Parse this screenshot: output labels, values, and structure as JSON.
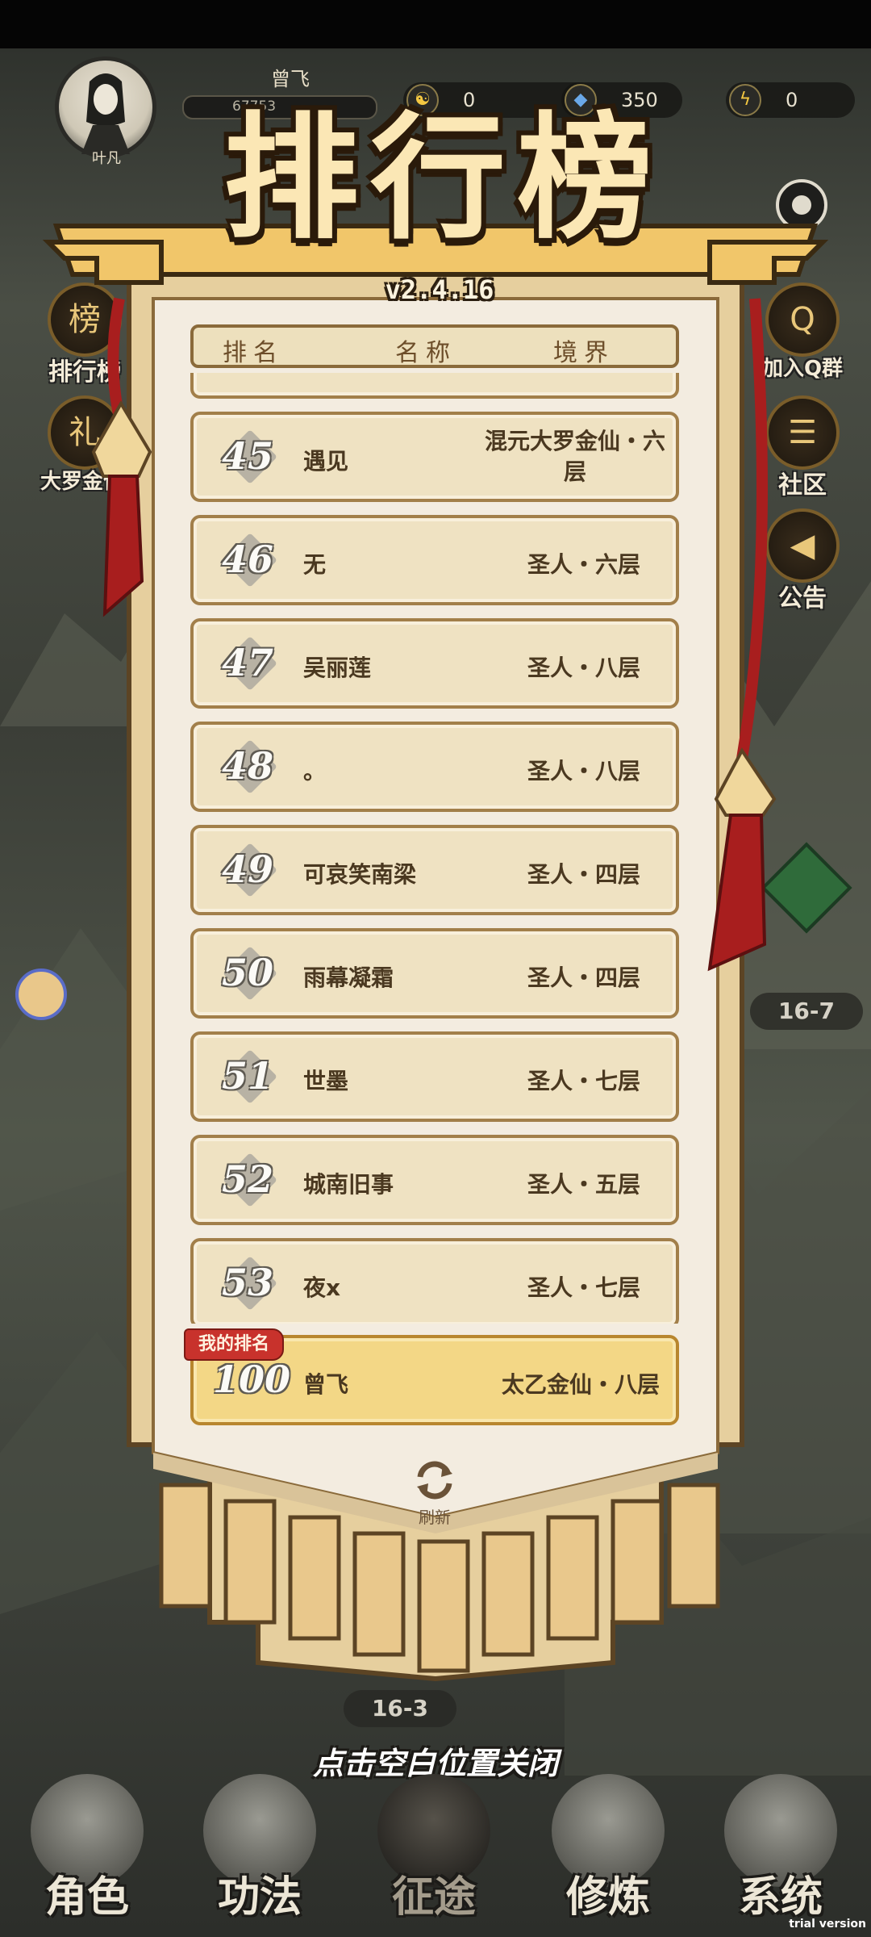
{
  "hud": {
    "avatar_name": "叶凡",
    "player_name": "曾飞",
    "xp_text": "67753",
    "resources": [
      {
        "icon": "yin-yang-icon",
        "value": "0"
      },
      {
        "icon": "spirit-stone-icon",
        "value": "350"
      },
      {
        "icon": "lightning-icon",
        "value": "0"
      }
    ]
  },
  "side_left": [
    {
      "label": "排行榜",
      "icon": "ranking-icon",
      "glyph": "榜"
    },
    {
      "label": "大罗金仙礼包",
      "icon": "gift-icon",
      "glyph": "礼"
    }
  ],
  "side_right": [
    {
      "label": "加入Q群",
      "icon": "penguin-icon",
      "glyph": "Q"
    },
    {
      "label": "社区",
      "icon": "chat-icon",
      "glyph": "☰"
    },
    {
      "label": "公告",
      "icon": "speaker-icon",
      "glyph": "◀"
    }
  ],
  "stages": [
    "16-7",
    "16-3"
  ],
  "ranking": {
    "title": "排行榜",
    "version": "v2.4.16",
    "headers": {
      "rank": "排名",
      "name": "名称",
      "realm": "境界"
    },
    "rows": [
      {
        "rank": "45",
        "name": "遇见",
        "realm": "混元大罗金仙・六层"
      },
      {
        "rank": "46",
        "name": "无",
        "realm": "圣人・六层"
      },
      {
        "rank": "47",
        "name": "吴丽莲",
        "realm": "圣人・八层"
      },
      {
        "rank": "48",
        "name": "。",
        "realm": "圣人・八层"
      },
      {
        "rank": "49",
        "name": "可哀笑南梁",
        "realm": "圣人・四层"
      },
      {
        "rank": "50",
        "name": "雨幕凝霜",
        "realm": "圣人・四层"
      },
      {
        "rank": "51",
        "name": "世墨",
        "realm": "圣人・七层"
      },
      {
        "rank": "52",
        "name": "城南旧事",
        "realm": "圣人・五层"
      },
      {
        "rank": "53",
        "name": "夜x",
        "realm": "圣人・七层"
      }
    ],
    "my_rank": {
      "tag": "我的排名",
      "rank": "100",
      "name": "曾飞",
      "realm": "太乙金仙・八层"
    },
    "refresh_label": "刷新",
    "close_hint": "点击空白位置关闭"
  },
  "bottom_nav": [
    {
      "label": "角色",
      "icon": "character-icon"
    },
    {
      "label": "功法",
      "icon": "scroll-book-icon"
    },
    {
      "label": "征途",
      "icon": "sword-icon",
      "active": true
    },
    {
      "label": "修炼",
      "icon": "meditate-icon"
    },
    {
      "label": "系统",
      "icon": "system-icon"
    }
  ],
  "watermark": "trial version",
  "colors": {
    "panel_cream": "#efe2c2",
    "border_brown": "#a27f4a",
    "my_rank_gold": "#f3d786",
    "tag_red": "#c8322c",
    "tassel_red": "#a81e1e"
  }
}
